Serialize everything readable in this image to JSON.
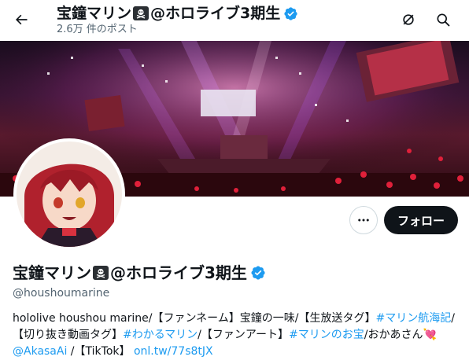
{
  "header": {
    "title_prefix": "宝鐘マリン",
    "title_suffix": "@ホロライブ3期生",
    "post_count": "2.6万 件のポスト"
  },
  "profile": {
    "name_prefix": "宝鐘マリン",
    "name_suffix": "@ホロライブ3期生",
    "handle": "@houshoumarine",
    "follow_label": "フォロー",
    "bio": {
      "t1": "hololive houshou marine/【ファンネーム】宝鐘の一味/【生放送タグ】",
      "tag1": "#マリン航海記",
      "t2": "/【切り抜き動画タグ】",
      "tag2": "#わかるマリン",
      "t3": "/【ファンアート】",
      "tag3": "#マリンのお宝",
      "t4": "/おかあさん",
      "heart": "💘",
      "mention": "@AkasaAi",
      "t5": " /【TikTok】",
      "link": "onl.tw/77s8tJX"
    }
  },
  "icons": {
    "back": "arrow-left-icon",
    "notify": "bell-slash-icon",
    "search": "search-icon",
    "more": "more-horizontal-icon",
    "verified": "verified-badge-icon",
    "pirate": "skull-crossbones-icon"
  },
  "colors": {
    "accent": "#1d9bf0",
    "text": "#0f1419",
    "muted": "#536471",
    "follow_bg": "#0f1419"
  }
}
